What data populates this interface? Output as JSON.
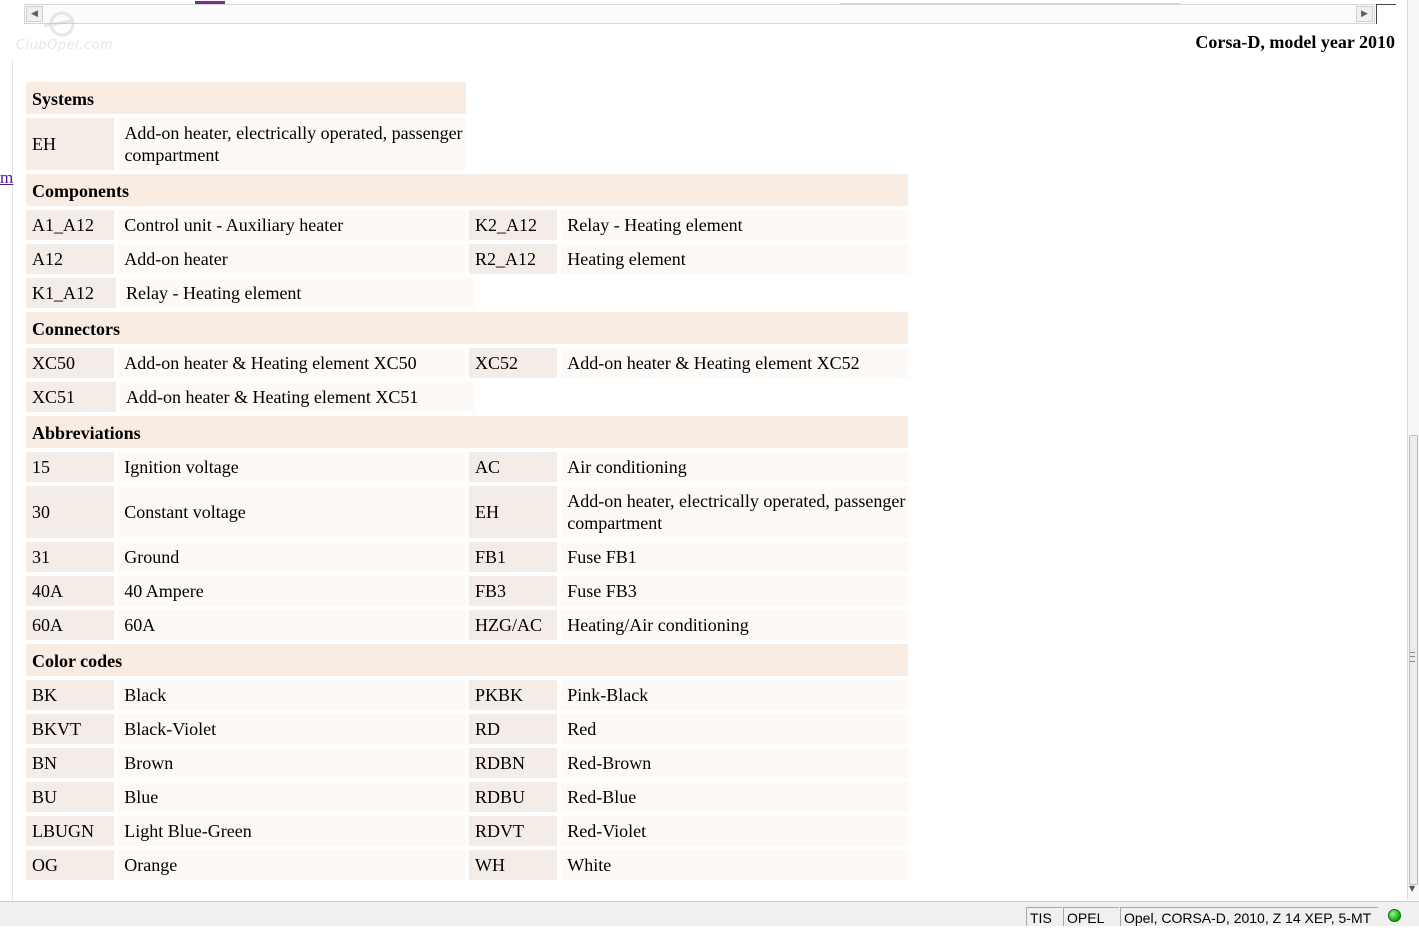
{
  "watermark": {
    "text": "ClubOpel.com"
  },
  "left_link": {
    "text": "m"
  },
  "document": {
    "title": "Corsa-D, model year 2010"
  },
  "sections": {
    "systems": {
      "header": "Systems",
      "rows": [
        {
          "code_l": "EH",
          "desc_l": "Add-on heater, electrically operated, passenger compartment"
        }
      ]
    },
    "components": {
      "header": "Components",
      "rows": [
        {
          "code_l": "A1_A12",
          "desc_l": "Control unit - Auxiliary heater",
          "code_r": "K2_A12",
          "desc_r": "Relay - Heating element"
        },
        {
          "code_l": "A12",
          "desc_l": "Add-on heater",
          "code_r": "R2_A12",
          "desc_r": "Heating element"
        },
        {
          "code_l": "K1_A12",
          "desc_l": "Relay - Heating element"
        }
      ]
    },
    "connectors": {
      "header": "Connectors",
      "rows": [
        {
          "code_l": "XC50",
          "desc_l": "Add-on heater & Heating element XC50",
          "code_r": "XC52",
          "desc_r": "Add-on heater & Heating element XC52"
        },
        {
          "code_l": "XC51",
          "desc_l": "Add-on heater & Heating element XC51"
        }
      ]
    },
    "abbreviations": {
      "header": "Abbreviations",
      "rows": [
        {
          "code_l": "15",
          "desc_l": "Ignition voltage",
          "code_r": "AC",
          "desc_r": "Air conditioning"
        },
        {
          "code_l": "30",
          "desc_l": "Constant voltage",
          "code_r": "EH",
          "desc_r": "Add-on heater, electrically operated, passenger compartment"
        },
        {
          "code_l": "31",
          "desc_l": "Ground",
          "code_r": "FB1",
          "desc_r": "Fuse FB1"
        },
        {
          "code_l": "40A",
          "desc_l": "40 Ampere",
          "code_r": "FB3",
          "desc_r": "Fuse FB3"
        },
        {
          "code_l": "60A",
          "desc_l": "60A",
          "code_r": "HZG/AC",
          "desc_r": "Heating/Air conditioning"
        }
      ]
    },
    "color_codes": {
      "header": "Color codes",
      "rows": [
        {
          "code_l": "BK",
          "desc_l": "Black",
          "code_r": "PKBK",
          "desc_r": "Pink-Black"
        },
        {
          "code_l": "BKVT",
          "desc_l": "Black-Violet",
          "code_r": "RD",
          "desc_r": "Red"
        },
        {
          "code_l": "BN",
          "desc_l": "Brown",
          "code_r": "RDBN",
          "desc_r": "Red-Brown"
        },
        {
          "code_l": "BU",
          "desc_l": "Blue",
          "code_r": "RDBU",
          "desc_r": "Red-Blue"
        },
        {
          "code_l": "LBUGN",
          "desc_l": "Light Blue-Green",
          "code_r": "RDVT",
          "desc_r": "Red-Violet"
        },
        {
          "code_l": "OG",
          "desc_l": "Orange",
          "code_r": "WH",
          "desc_r": "White"
        }
      ]
    }
  },
  "statusbar": {
    "tis": "TIS",
    "brand": "OPEL",
    "vehicle": "Opel, CORSA-D, 2010, Z 14 XEP, 5-MT",
    "connection_status_color": "#22b31e"
  },
  "icons": {
    "scroll_left": "scroll-left-arrow-icon",
    "scroll_right": "scroll-right-arrow-icon",
    "status_led": "green-status-led-icon"
  }
}
